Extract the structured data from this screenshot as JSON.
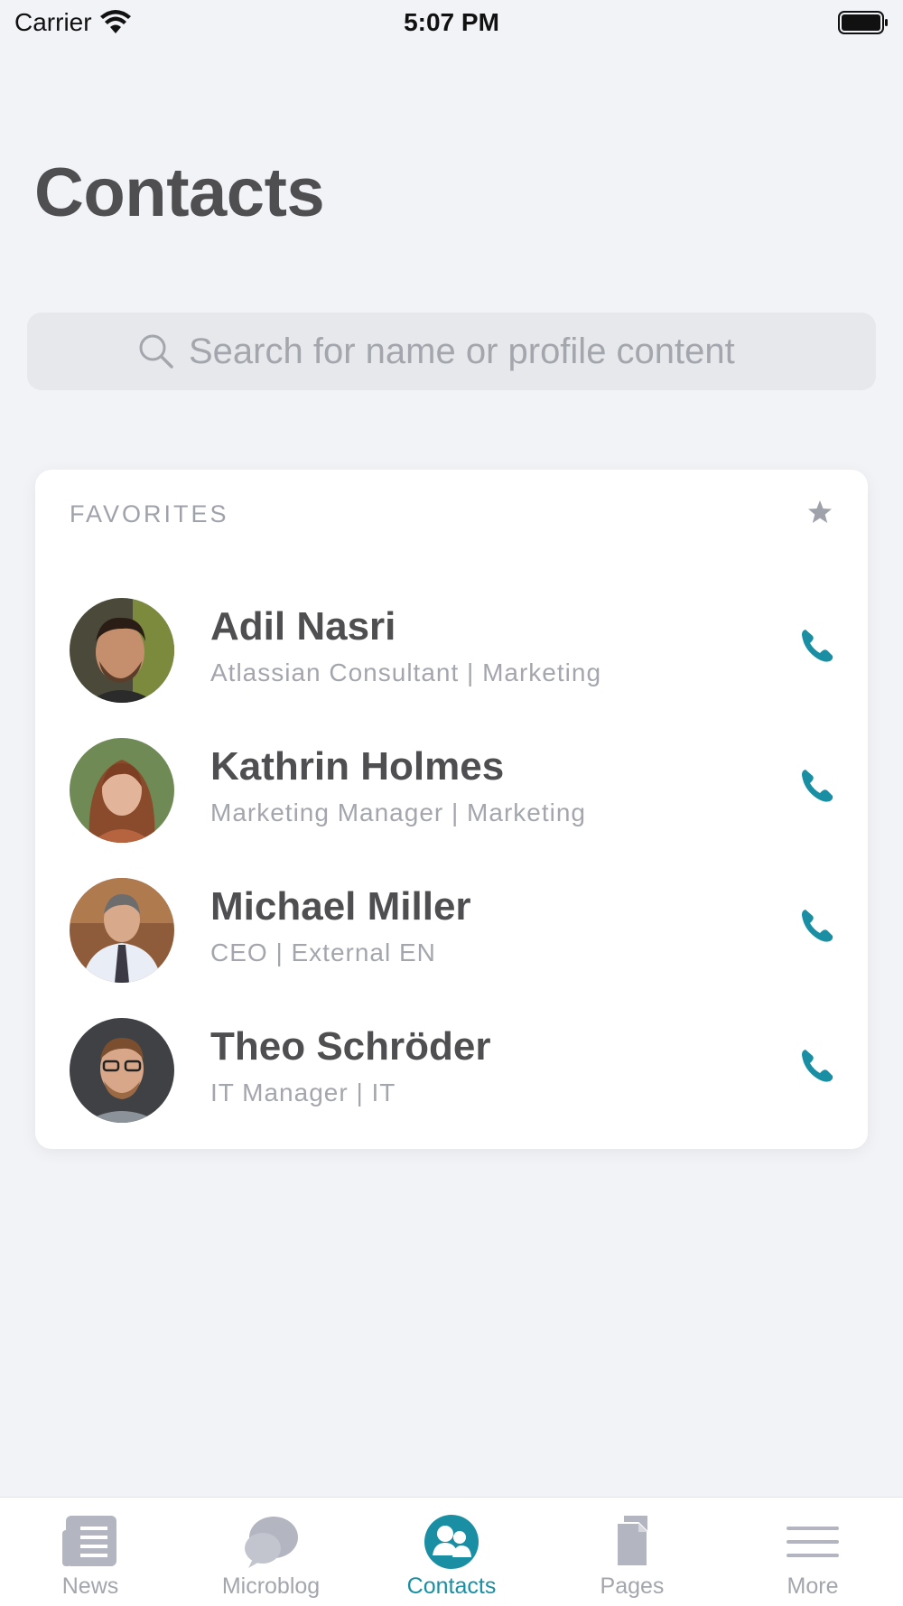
{
  "status_bar": {
    "carrier": "Carrier",
    "time": "5:07 PM"
  },
  "page": {
    "title": "Contacts"
  },
  "search": {
    "placeholder": "Search for name or profile content",
    "value": ""
  },
  "favorites": {
    "header": "FAVORITES",
    "contacts": [
      {
        "name": "Adil Nasri",
        "subtitle": "Atlassian Consultant | Marketing"
      },
      {
        "name": "Kathrin Holmes",
        "subtitle": "Marketing Manager | Marketing"
      },
      {
        "name": "Michael Miller",
        "subtitle": "CEO | External EN"
      },
      {
        "name": "Theo Schröder",
        "subtitle": "IT Manager | IT"
      }
    ]
  },
  "tab_bar": {
    "tabs": [
      {
        "label": "News",
        "icon": "news-icon"
      },
      {
        "label": "Microblog",
        "icon": "microblog-icon"
      },
      {
        "label": "Contacts",
        "icon": "contacts-icon",
        "active": true
      },
      {
        "label": "Pages",
        "icon": "pages-icon"
      },
      {
        "label": "More",
        "icon": "menu-icon"
      }
    ]
  },
  "colors": {
    "accent": "#1a8fa3",
    "inactive": "#a4a6ad",
    "background": "#f2f3f7"
  }
}
